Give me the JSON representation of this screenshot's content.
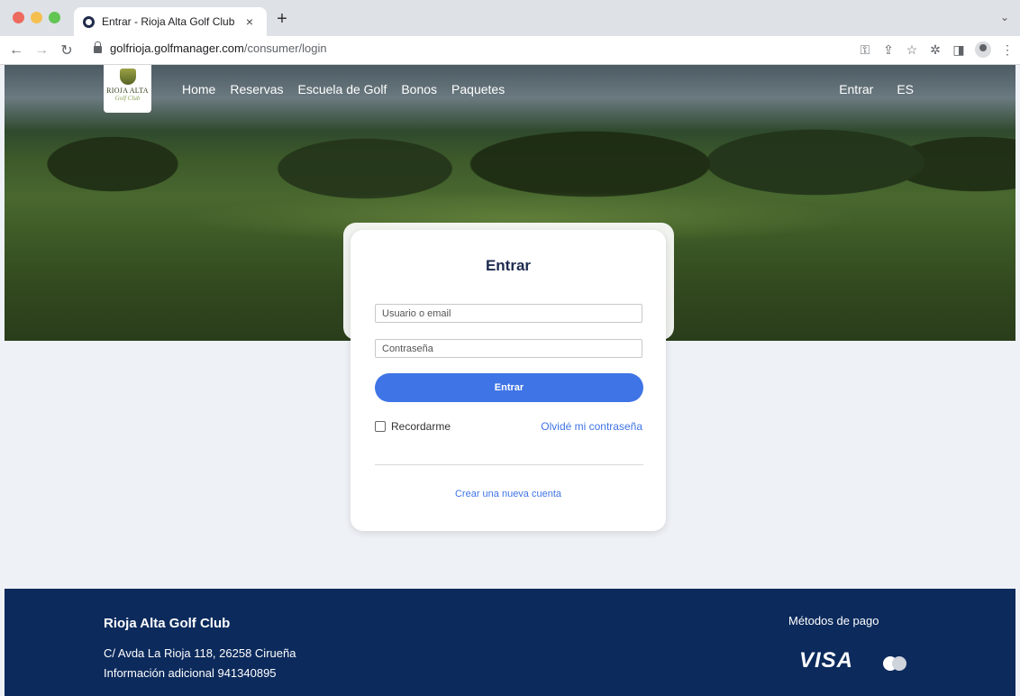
{
  "browser": {
    "tab_title": "Entrar - Rioja Alta Golf Club",
    "tab_close": "×",
    "new_tab": "+",
    "url_domain": "golfrioja.golfmanager.com",
    "url_path": "/consumer/login"
  },
  "site": {
    "logo_text": "RIOJA ALTA",
    "logo_script": "Golf Club",
    "nav": [
      "Home",
      "Reservas",
      "Escuela de Golf",
      "Bonos",
      "Paquetes"
    ],
    "nav_right": [
      "Entrar",
      "ES"
    ]
  },
  "login": {
    "title": "Entrar",
    "user_placeholder": "Usuario o email",
    "password_placeholder": "Contraseña",
    "submit_label": "Entrar",
    "remember_label": "Recordarme",
    "forgot_label": "Olvidé mi contraseña",
    "create_account_label": "Crear una nueva cuenta"
  },
  "footer": {
    "club_name": "Rioja Alta Golf Club",
    "address": "C/ Avda La Rioja 118, 26258 Cirueña",
    "info": "Información adicional 941340895",
    "payment_title": "Métodos de pago",
    "visa_label": "VISA"
  },
  "colors": {
    "accent": "#3f74e6",
    "footer_bg": "#0c2a5c",
    "title_navy": "#1d2b4f"
  }
}
